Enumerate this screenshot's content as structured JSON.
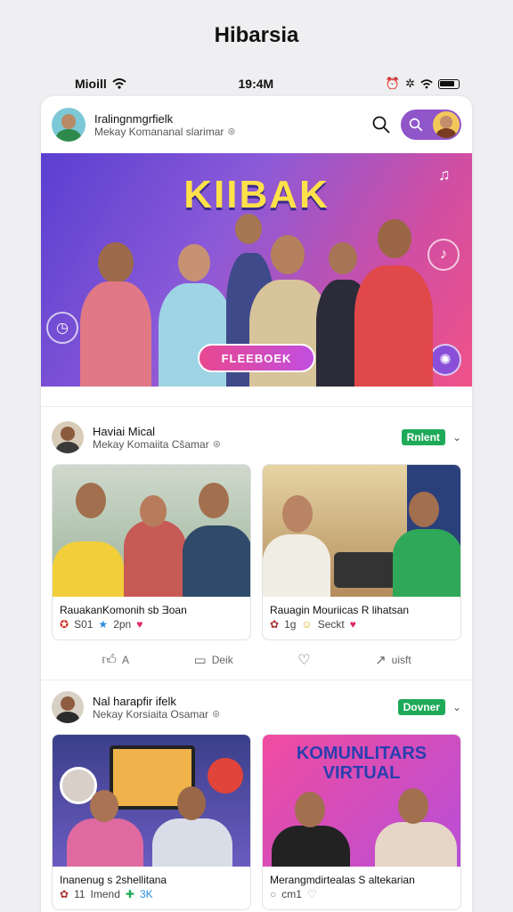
{
  "app_title": "Hibarsia",
  "status": {
    "carrier": "Mioill",
    "time": "19:4M"
  },
  "header": {
    "name": "Iralingnmgrfielk",
    "sub": "Mekay Komananal slarimar"
  },
  "banner": {
    "title": "KIIBAK",
    "button": "FLEEBOEK"
  },
  "posts": [
    {
      "name": "Haviai Mical",
      "sub": "Mekay Komaiita Cŝamar",
      "tag": "Rnlent",
      "tiles": [
        {
          "title": "RauakanKomonih sb Ǝoan",
          "meta1": "S01",
          "meta2": "2pn"
        },
        {
          "title": "Rauagin Mouriicas R lihatsan",
          "meta1": "1g",
          "meta2": "Seckt"
        }
      ],
      "actions": {
        "like": "A",
        "comment": "Deik",
        "share": "uisft"
      }
    },
    {
      "name": "Nal harapfir ifelk",
      "sub": "Nekay Korsiaita Osamar",
      "tag": "Dovner",
      "tiles": [
        {
          "title": "Inanenug s 2shellitana",
          "meta1": "11",
          "meta2": "Imend",
          "meta3": "3K"
        },
        {
          "title": "Merangmdirtealas S altekarian",
          "meta1": "cm1",
          "meta2": ""
        }
      ],
      "tile_banner": "KOMUNLITARS VIRTUAL"
    }
  ],
  "colors": {
    "accent_purple": "#8f55c9",
    "tag_green": "#1eaa59",
    "banner_title": "#ffe14a",
    "heart": "#e0245e"
  }
}
